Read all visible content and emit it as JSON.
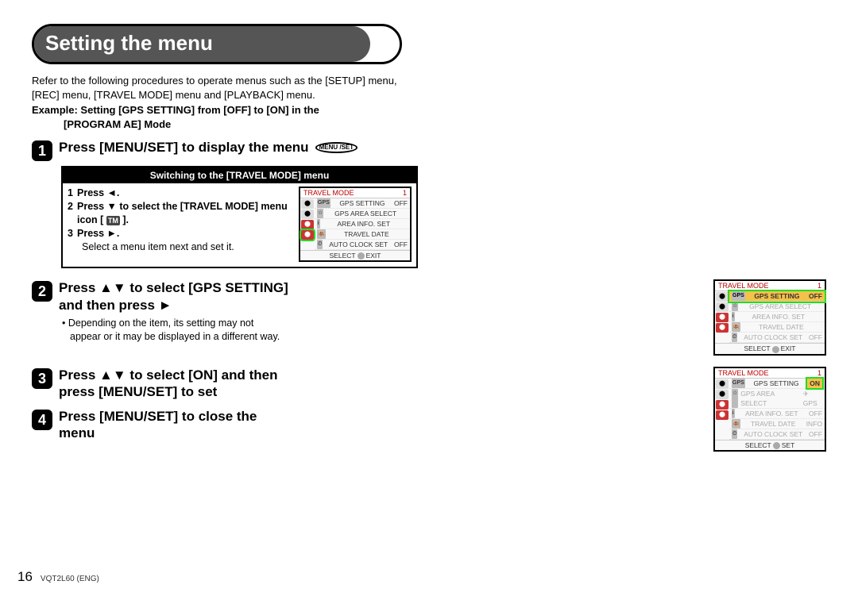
{
  "title": "Setting the menu",
  "intro": "Refer to the following procedures to operate menus such as the [SETUP] menu, [REC] menu, [TRAVEL MODE] menu and [PLAYBACK] menu.",
  "example_line1": "Example: Setting [GPS SETTING] from [OFF] to [ON] in the",
  "example_line2": "[PROGRAM AE] Mode",
  "step1": {
    "num": "1",
    "text": "Press [MENU/SET] to display the menu",
    "icon": "MENU /SET"
  },
  "subbox": {
    "header": "Switching to the [TRAVEL MODE] menu",
    "s1_n": "1",
    "s1_t": "Press ◄.",
    "s2_n": "2",
    "s2_t_a": "Press ▼ to select the [TRAVEL MODE] menu icon [",
    "s2_chip": "TM",
    "s2_t_b": " ].",
    "s3_n": "3",
    "s3_t": "Press ►.",
    "bullet": "Select a menu item next and set it."
  },
  "shot_common": {
    "title": "TRAVEL MODE",
    "page": "1",
    "r1_tag": "GPS",
    "r1": "GPS SETTING",
    "r1_val_off": "OFF",
    "r1_val_on": "ON",
    "r2_tag": "☆",
    "r2": "GPS AREA SELECT",
    "r3_tag": "i",
    "r3": "AREA INFO. SET",
    "r4_tag": "🏨",
    "r4": "TRAVEL DATE",
    "r5_tag": "⏲",
    "r5": "AUTO CLOCK SET",
    "r5_val": "OFF",
    "footer_select": "SELECT",
    "footer_exit": "EXIT",
    "footer_set": "SET",
    "val_tgps": "✈GPS",
    "val_info": "INFO"
  },
  "step2": {
    "num": "2",
    "text": "Press ▲▼ to select [GPS SETTING] and then press ►",
    "note": "Depending on the item, its setting may not appear or it may be displayed in a different way."
  },
  "step3": {
    "num": "3",
    "text": "Press ▲▼ to select [ON] and then press [MENU/SET] to set"
  },
  "step4": {
    "num": "4",
    "text": "Press [MENU/SET] to close the menu"
  },
  "footer": {
    "page": "16",
    "doc": "VQT2L60 (ENG)"
  }
}
